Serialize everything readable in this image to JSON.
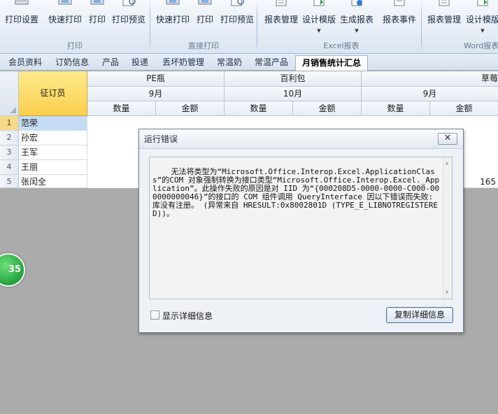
{
  "ribbon": {
    "groups": [
      {
        "label": "打印",
        "buttons": [
          {
            "label": "打印设置",
            "icon": "printer-settings-icon"
          },
          {
            "label": "快速打印",
            "icon": "quick-print-icon"
          },
          {
            "label": "打印",
            "icon": "print-icon"
          },
          {
            "label": "打印预览",
            "icon": "print-preview-icon"
          }
        ]
      },
      {
        "label": "直接打印",
        "buttons": [
          {
            "label": "快速打印",
            "icon": "quick-print-icon"
          },
          {
            "label": "打印",
            "icon": "print-icon"
          },
          {
            "label": "打印预览",
            "icon": "print-preview-icon"
          }
        ]
      },
      {
        "label": "Excel报表",
        "buttons": [
          {
            "label": "报表管理",
            "icon": "report-manage-icon"
          },
          {
            "label": "设计模版",
            "icon": "design-template-icon",
            "dropdown": true
          },
          {
            "label": "生成报表",
            "icon": "generate-report-icon",
            "dropdown": true
          }
        ]
      },
      {
        "label": "",
        "buttons": [
          {
            "label": "报表事件",
            "icon": "report-event-icon"
          }
        ]
      },
      {
        "label": "Word报表",
        "buttons": [
          {
            "label": "报表管理",
            "icon": "report-manage-icon"
          },
          {
            "label": "设计模版",
            "icon": "design-template-icon",
            "dropdown": true
          }
        ]
      }
    ]
  },
  "tabs": [
    {
      "label": "会员资料",
      "active": false
    },
    {
      "label": "订奶信息",
      "active": false
    },
    {
      "label": "产品",
      "active": false
    },
    {
      "label": "投递",
      "active": false
    },
    {
      "label": "丢坏奶管理",
      "active": false
    },
    {
      "label": "常温奶",
      "active": false
    },
    {
      "label": "常温产品",
      "active": false
    },
    {
      "label": "月销售统计汇总",
      "active": true
    }
  ],
  "grid": {
    "rowheader_label": "征订员",
    "products": [
      "PE瓶",
      "百利包",
      "草莓"
    ],
    "months": [
      "9月",
      "10月",
      "9月"
    ],
    "measures": [
      "数量",
      "金额",
      "数量",
      "金额",
      "数量",
      "金额"
    ],
    "rows": [
      {
        "num": "1",
        "name": "范荣",
        "values": []
      },
      {
        "num": "2",
        "name": "孙宏",
        "values": []
      },
      {
        "num": "3",
        "name": "王军",
        "values": []
      },
      {
        "num": "4",
        "name": "王丽",
        "values": []
      },
      {
        "num": "5",
        "name": "张闰全",
        "values": [
          "165"
        ]
      }
    ]
  },
  "badge": {
    "text": "35"
  },
  "dialog": {
    "title": "运行错误",
    "close_label": "✕",
    "message": "无法将类型为“Microsoft.Office.Interop.Excel.ApplicationClass”的COM 对象强制转换为接口类型“Microsoft.Office.Interop.Excel._Application”。此操作失败的原因是对 IID 为“{000208D5-0000-0000-C000-000000000046}”的接口的 COM 组件调用 QueryInterface 因以下错误而失败: 库没有注册。 (异常来自 HRESULT:0x8002801D (TYPE_E_LIBNOTREGISTERED))。",
    "checkbox_label": "显示详细信息",
    "copy_button_label": "复制详细信息"
  },
  "colors": {
    "ribbon_bg": "#e7eef7",
    "header_highlight": "#fbd04e",
    "selected_row": "#f8d98a",
    "dialog_bg": "#eef2f7",
    "workspace": "#ababab",
    "badge": "#22a33a"
  }
}
